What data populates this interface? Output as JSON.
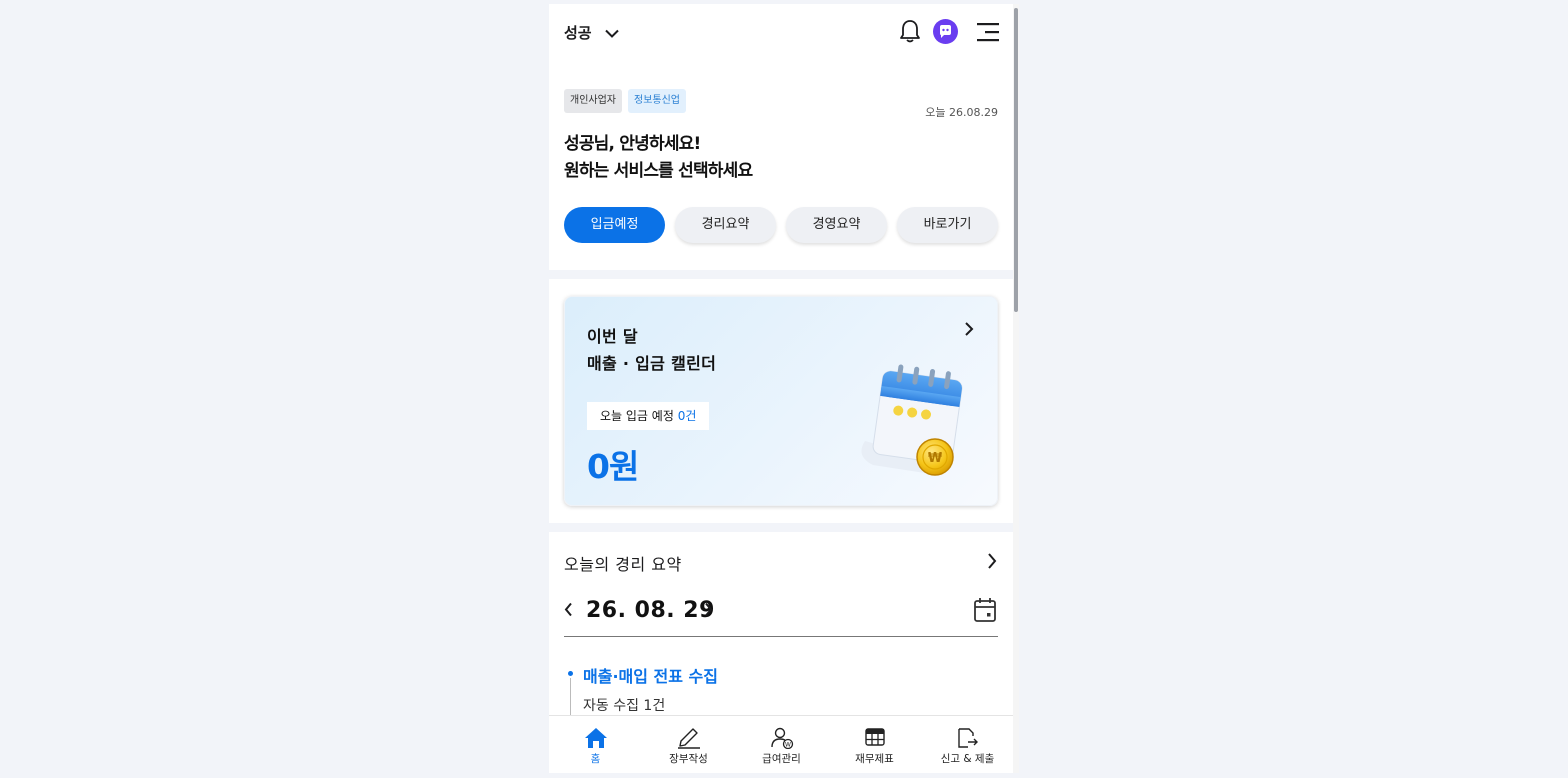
{
  "header": {
    "business_name": "성공",
    "icons": [
      "chevron-down-icon",
      "bell-icon",
      "avatar",
      "menu-icon"
    ]
  },
  "greeting": {
    "tags": [
      "개인사업자",
      "정보통신업"
    ],
    "today_label": "오늘 26.08.29",
    "line1": "성공님, 안녕하세요!",
    "line2": "원하는 서비스를 선택하세요",
    "tabs": [
      {
        "label": "입금예정",
        "active": true
      },
      {
        "label": "경리요약",
        "active": false
      },
      {
        "label": "경영요약",
        "active": false
      },
      {
        "label": "바로가기",
        "active": false
      }
    ]
  },
  "calendar_card": {
    "title_line1": "이번 달",
    "title_line2": "매출 · 입금 캘린더",
    "badge_label": "오늘 입금 예정",
    "badge_count": "0건",
    "amount": "0원"
  },
  "summary": {
    "title": "오늘의 경리 요약",
    "date": "26. 08. 29",
    "timeline": [
      {
        "heading": "매출·매입 전표 수집",
        "sub": "자동 수집 1건"
      }
    ]
  },
  "bottom_nav": [
    {
      "label": "홈",
      "icon": "home-icon",
      "active": true
    },
    {
      "label": "장부작성",
      "icon": "pen-icon",
      "active": false
    },
    {
      "label": "급여관리",
      "icon": "payroll-icon",
      "active": false
    },
    {
      "label": "재무제표",
      "icon": "table-icon",
      "active": false
    },
    {
      "label": "신고 & 제출",
      "icon": "submit-icon",
      "active": false
    }
  ],
  "colors": {
    "accent": "#0b72e7",
    "page_bg": "#f2f4f9",
    "avatar": "#6a3df0"
  }
}
